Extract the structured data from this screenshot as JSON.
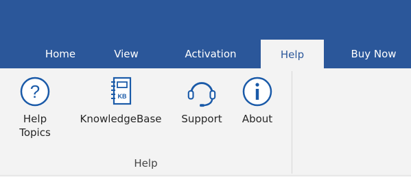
{
  "tabs": {
    "home": "Home",
    "view": "View",
    "activation": "Activation",
    "help": "Help",
    "buy_now": "Buy Now"
  },
  "ribbon": {
    "help_topics": "Help\nTopics",
    "knowledgebase": "KnowledgeBase",
    "support": "Support",
    "about": "About",
    "group_label": "Help",
    "kb_badge": "KB"
  },
  "colors": {
    "accent": "#2b579a",
    "ribbon_bg": "#f3f3f3",
    "icon_blue": "#1a5aa8"
  }
}
